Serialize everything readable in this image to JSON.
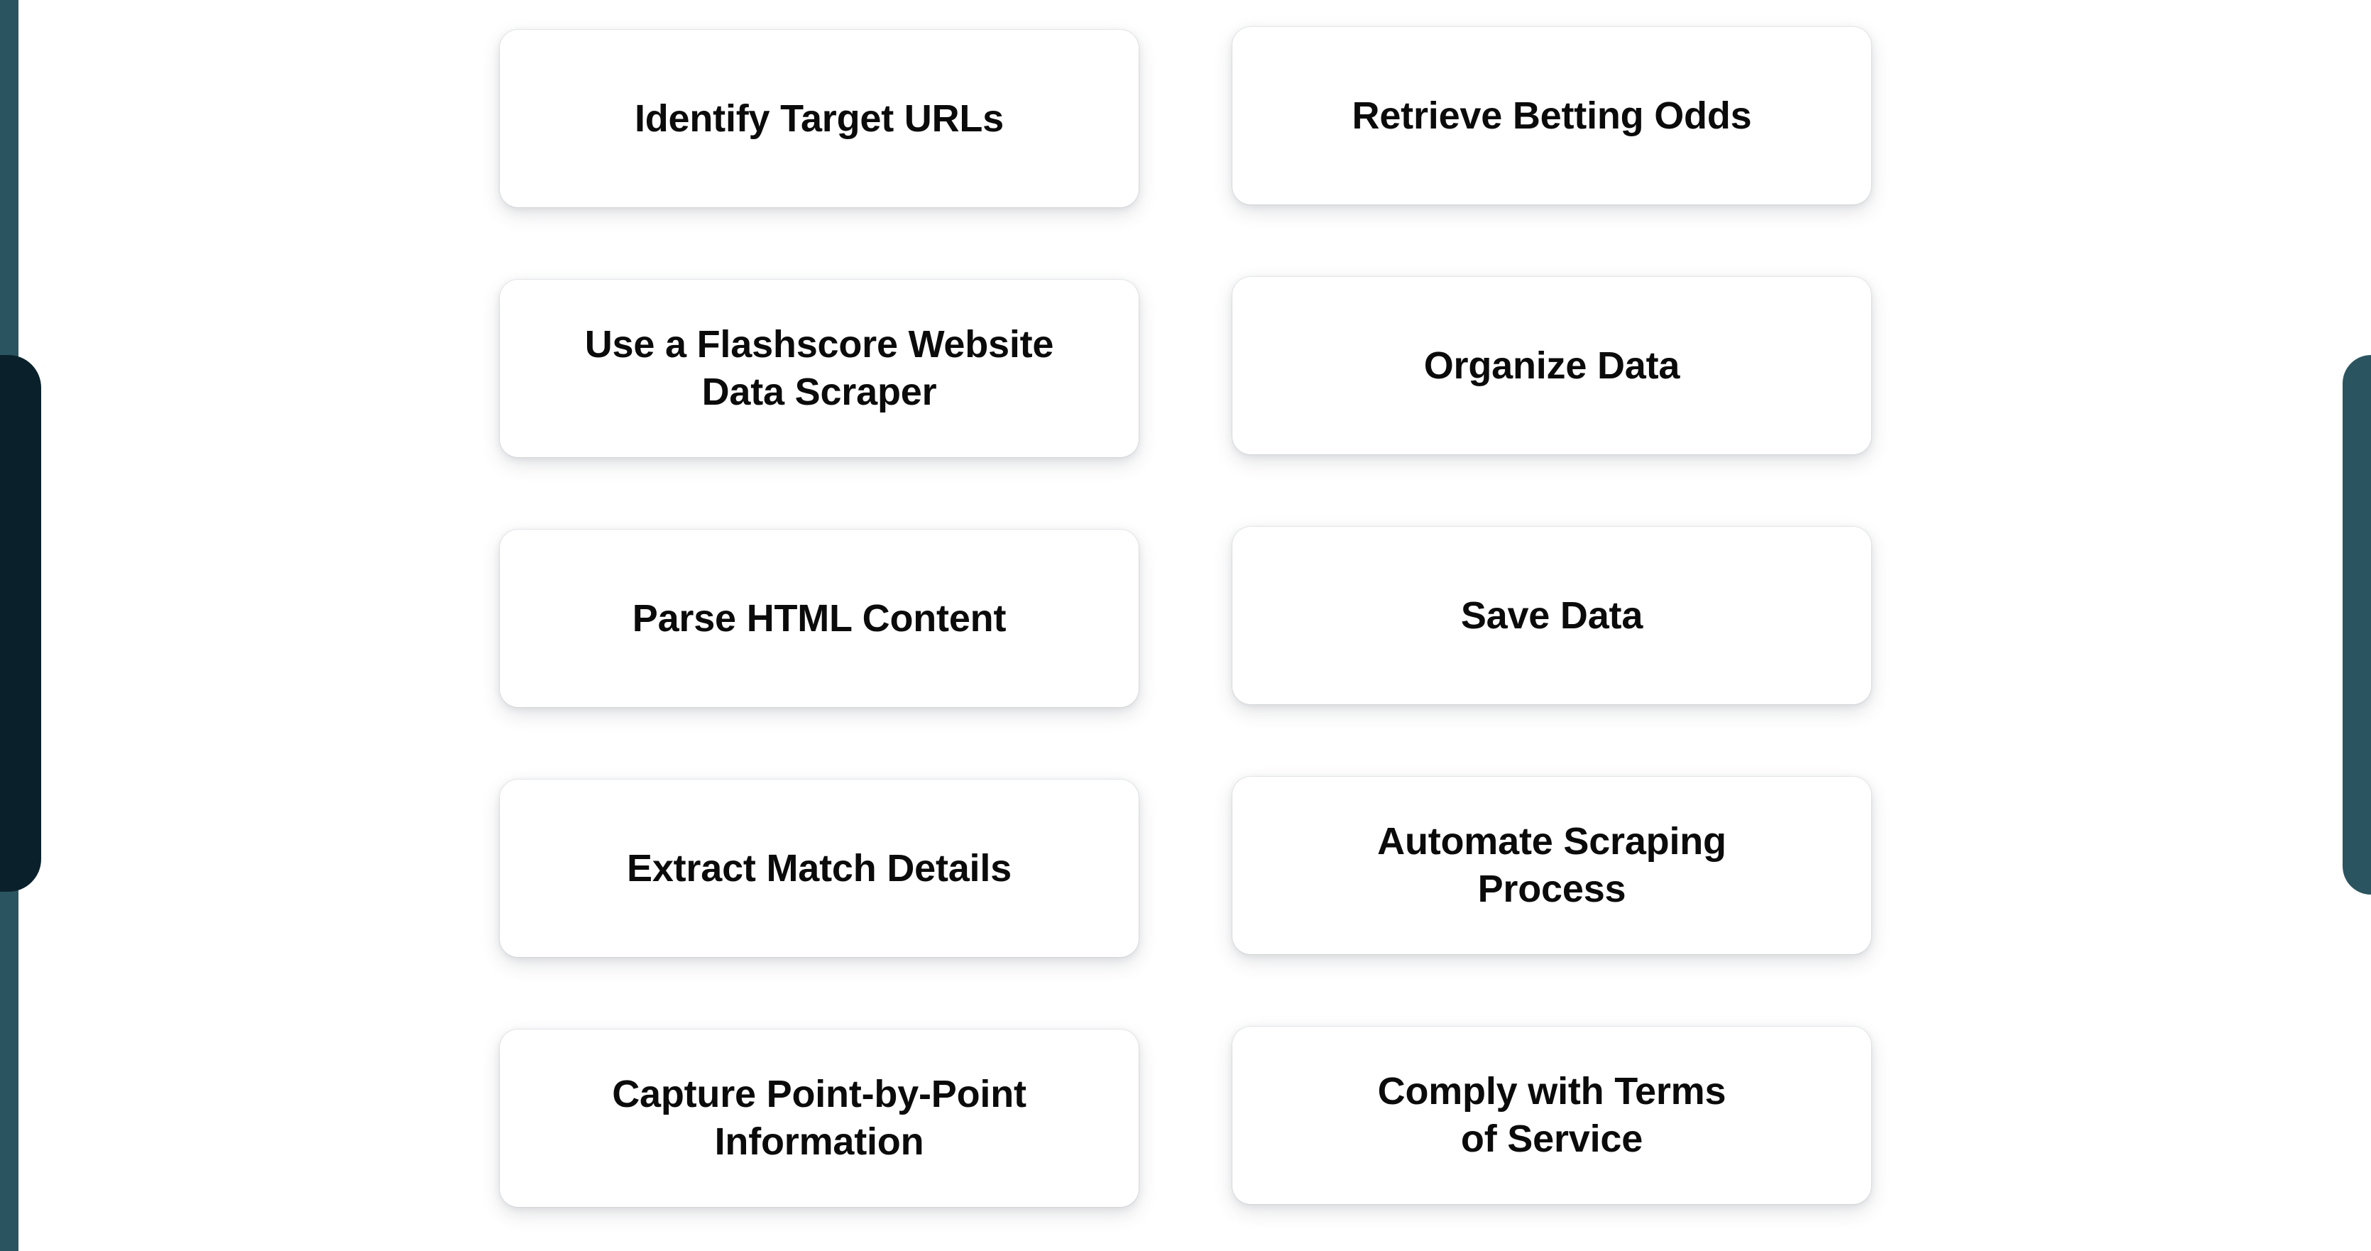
{
  "page": {
    "background_color": "#ffffff",
    "card_background_color": "#ffffff",
    "card_text_color": "#0b0b0c"
  },
  "decorations": {
    "left_strip_color": "#2a5560",
    "left_panel_color": "#0a212b",
    "right_panel_color": "#2a5560"
  },
  "steps": {
    "left_column": [
      {
        "label": "Identify Target URLs"
      },
      {
        "label": "Use a Flashscore Website\nData Scraper"
      },
      {
        "label": "Parse HTML Content"
      },
      {
        "label": "Extract Match Details"
      },
      {
        "label": "Capture Point-by-Point\nInformation"
      }
    ],
    "right_column": [
      {
        "label": "Retrieve Betting Odds"
      },
      {
        "label": "Organize Data"
      },
      {
        "label": "Save Data"
      },
      {
        "label": "Automate Scraping\nProcess"
      },
      {
        "label": "Comply with Terms\nof Service"
      }
    ]
  }
}
